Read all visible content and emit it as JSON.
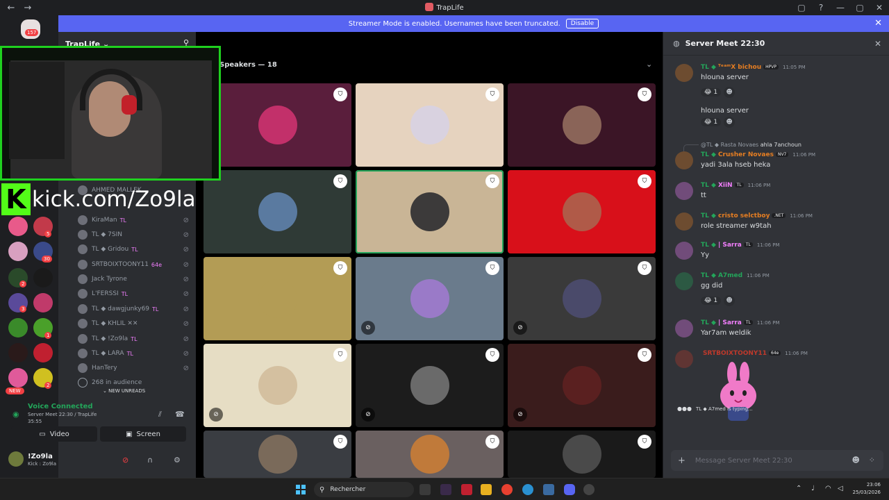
{
  "window": {
    "title": "TrapLife",
    "back": "←",
    "forward": "→",
    "controls": [
      "▢",
      "?",
      "—",
      "▢",
      "✕"
    ]
  },
  "banner": {
    "text": "Streamer Mode is enabled. Usernames have been truncated.",
    "button": "Disable",
    "close": "✕"
  },
  "guilds": {
    "home_badge": "157",
    "badges": [
      "5",
      "30",
      "2",
      "3",
      "1",
      "2"
    ],
    "new_label": "NEW"
  },
  "server": {
    "name": "TrapLife",
    "chevron": "⌄",
    "invite_icon": "⚲"
  },
  "overlay": {
    "kick_letter": "K",
    "kick_text": "kick.com/Zo9la"
  },
  "members": [
    {
      "name": "AHMED MALLEK",
      "tag": ""
    },
    {
      "name": "KiraMan",
      "tag": "TL"
    },
    {
      "name": "TL ◆ 7SIN",
      "tag": ""
    },
    {
      "name": "TL ◆ Gridou",
      "tag": "TL"
    },
    {
      "name": "SRTBOIXTOONY11",
      "tag": "64e"
    },
    {
      "name": "Jack Tyrone",
      "tag": ""
    },
    {
      "name": "L'FERSSI",
      "tag": "TL"
    },
    {
      "name": "TL ◆ dawgjunky69",
      "tag": "TL"
    },
    {
      "name": "TL ◆ KHLIL ✕✕",
      "tag": ""
    },
    {
      "name": "TL ◆ !Zo9la",
      "tag": "TL"
    },
    {
      "name": "TL ◆ LARA",
      "tag": "TL"
    },
    {
      "name": "HanTery",
      "tag": ""
    },
    {
      "name": "268 in audience",
      "tag": ""
    }
  ],
  "new_unreads": "⌄ NEW UNREADS",
  "voice": {
    "status": "Voice Connected",
    "channel": "Server Meet 22:30 / TrapLife",
    "elapsed": "35:55",
    "video_label": "Video",
    "screen_label": "Screen"
  },
  "user": {
    "name": "!Zo9la",
    "status": "Kick : Zo9la"
  },
  "stage": {
    "title": "Speakers — 18",
    "chevron": "⌄"
  },
  "tiles": [
    {
      "bg": "#5a1e3c",
      "av": "#c2306a",
      "muted": false
    },
    {
      "bg": "#e6d3bf",
      "av": "#d9d2e0",
      "muted": false
    },
    {
      "bg": "#3b1526",
      "av": "#8a6458",
      "muted": false
    },
    {
      "bg": "#2f3a36",
      "av": "#5a7aa0",
      "muted": false
    },
    {
      "bg": "#c9b596",
      "av": "#3c3a3a",
      "muted": false,
      "speaking": true
    },
    {
      "bg": "#d8101a",
      "av": "#b05a48",
      "muted": false
    },
    {
      "bg": "#b39c55",
      "av": "#b39c55",
      "muted": false
    },
    {
      "bg": "#6a7b8c",
      "av": "#9a7ac8",
      "muted": true
    },
    {
      "bg": "#3a3a3a",
      "av": "#4a4a6a",
      "muted": true
    },
    {
      "bg": "#e6ddc4",
      "av": "#d4c0a0",
      "muted": true
    },
    {
      "bg": "#1c1c1c",
      "av": "#6a6a6a",
      "muted": true
    },
    {
      "bg": "#3a1c1c",
      "av": "#5a2020",
      "muted": true
    },
    {
      "bg": "#3a3d42",
      "av": "#7a6a5a",
      "muted": false
    },
    {
      "bg": "#6a6060",
      "av": "#c07a3a",
      "muted": false
    },
    {
      "bg": "#1a1a1a",
      "av": "#4a4a4a",
      "muted": false
    }
  ],
  "chat": {
    "title": "Server Meet 22:30",
    "messages": [
      {
        "tl": "TL ◆",
        "name": "ᵀᵉᵃᵐX bichou",
        "pill": "HPVP",
        "time": "11:05 PM",
        "body": "hlouna server",
        "color": "#e67e22"
      },
      {
        "body": "hlouna server"
      },
      {
        "reply": "@TL ◆ Rasta Novaes",
        "reply_text": "ahla 7anchoun",
        "tl": "TL ◆",
        "name": "Crusher Novaes",
        "pill": "NV7",
        "time": "11:06 PM",
        "body": "yadi 3ala hseb heka",
        "color": "#e67e22"
      },
      {
        "tl": "TL ◆",
        "name": "XiiN",
        "pill": "TL",
        "time": "11:06 PM",
        "body": "tt",
        "color": "#f47fff"
      },
      {
        "tl": "TL ◆",
        "name": "cristo selctboy",
        "pill": ".NET",
        "time": "11:06 PM",
        "body": "role streamer w9tah",
        "color": "#e67e22"
      },
      {
        "tl": "TL ◆",
        "name": "| Sarra",
        "pill": "TL",
        "time": "11:06 PM",
        "body": "Yy",
        "color": "#f47fff"
      },
      {
        "tl": "TL ◆",
        "name": "A7med",
        "pill": "",
        "time": "11:06 PM",
        "body": "gg did",
        "color": "#23a55a"
      },
      {
        "tl": "TL ◆",
        "name": "| Sarra",
        "pill": "TL",
        "time": "11:06 PM",
        "body": "Yar7am weldik",
        "color": "#f47fff"
      },
      {
        "tl": "",
        "name": "SRTBOIXTOONY11",
        "pill": "64e",
        "time": "11:06 PM",
        "body": "",
        "color": "#c0392b"
      }
    ],
    "reactions": {
      "count": "1",
      "emoji": "😂"
    },
    "typing": "TL ◆ A7med is typing...",
    "input_placeholder": "Message Server Meet 22:30"
  },
  "taskbar": {
    "search": "Rechercher",
    "time": "23:06",
    "date": "25/03/2026"
  }
}
